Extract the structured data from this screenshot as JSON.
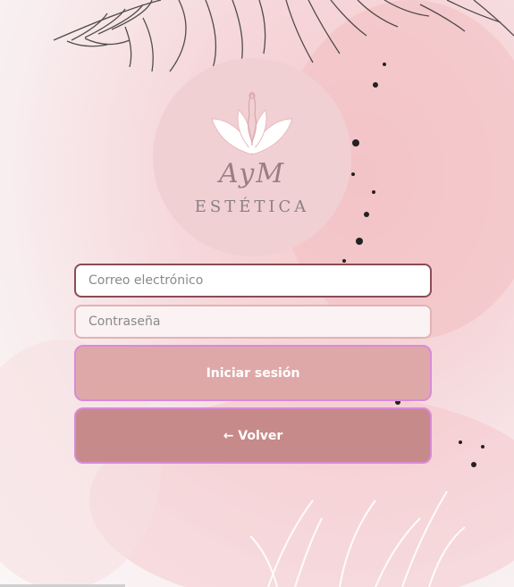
{
  "logo": {
    "script_text": "AyM",
    "word": "ESTÉTICA"
  },
  "form": {
    "email_placeholder": "Correo electrónico",
    "password_placeholder": "Contraseña",
    "login_label": "Iniciar sesión",
    "back_label": "← Volver"
  },
  "icons": {
    "logo_mark": "lotus-woman-icon"
  },
  "colors": {
    "login_button": "#dfa8a8",
    "back_button": "#c78a8a",
    "button_border": "#d88bd8",
    "email_border": "#8a4b55"
  }
}
